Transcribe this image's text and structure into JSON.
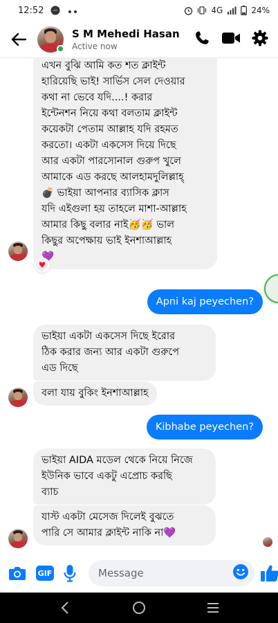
{
  "status_bar": {
    "time": "12:52",
    "network": "4G",
    "battery": "24%"
  },
  "header": {
    "contact_name": "S M Mehedi Hasan",
    "contact_status": "Active now"
  },
  "messages": [
    {
      "direction": "incoming",
      "lines": [
        "এখন বুঝি আমি কত শত ক্লাইন্ট",
        "হারিয়েছি ভাই! সার্ভিস সেল দেওয়ার",
        "কথা না ভেবে যদি....!  করার",
        "ইন্টেনশন নিয়ে কথা বলতাম ক্লাইন্ট",
        "কয়েকটা পেতাম আল্লাহ যদি রহমত",
        "করতো। একটা একসেস দিয়ে দিছে",
        "আর একটা পারসোনাল গুরুপ খুলে",
        "আমাকে এড করছে আলহামদুলিল্লাহ্",
        "💣 ভাইয়া আপনার ব্যাসিক ক্লাস",
        "যদি এইগুলা হয় তাহলে মাশা-আল্লাহ",
        "আমার কিছু বলার নাই🥳🥳 ভাল",
        "কিছুর অপেক্ষায় ভাই ইনশাআল্লাহ",
        "💜"
      ],
      "reaction": "♥"
    },
    {
      "direction": "outgoing",
      "text": "Apni kaj peyechen?"
    },
    {
      "direction": "incoming",
      "lines": [
        "ভাইয়া একটা একসেস দিছে ইরোর",
        "ঠিক করার জন্য আর একটা গুরুপে",
        "এড দিছে"
      ]
    },
    {
      "direction": "incoming",
      "lines": [
        "বলা যায় বুকিং ইনশাআল্লাহ"
      ]
    },
    {
      "direction": "outgoing",
      "text": "Kibhabe peyechen?"
    },
    {
      "direction": "incoming",
      "lines": [
        "ভাইয়া AIDA মডেল থেকে নিয়ে নিজে",
        "ইউনিক ভাবে একটু এপ্রোচ করছি",
        "ব্যাচ"
      ]
    },
    {
      "direction": "incoming",
      "lines": [
        "যাস্ট একটা মেসেজ দিলেই বুঝতে",
        "পারি সে আমার ক্লাইন্ট নাকি না💜"
      ]
    }
  ],
  "composer": {
    "gif_label": "GIF",
    "placeholder": "Message"
  },
  "colors": {
    "accent": "#0a7cff",
    "incoming_bubble": "#f0f0f0",
    "online": "#31a24c"
  },
  "icons": {
    "back": "arrow-left-icon",
    "call": "phone-icon",
    "video": "video-camera-icon",
    "settings": "gear-icon",
    "camera": "camera-icon",
    "mic": "microphone-icon",
    "emoji": "emoji-icon",
    "like": "thumbs-up-icon"
  }
}
